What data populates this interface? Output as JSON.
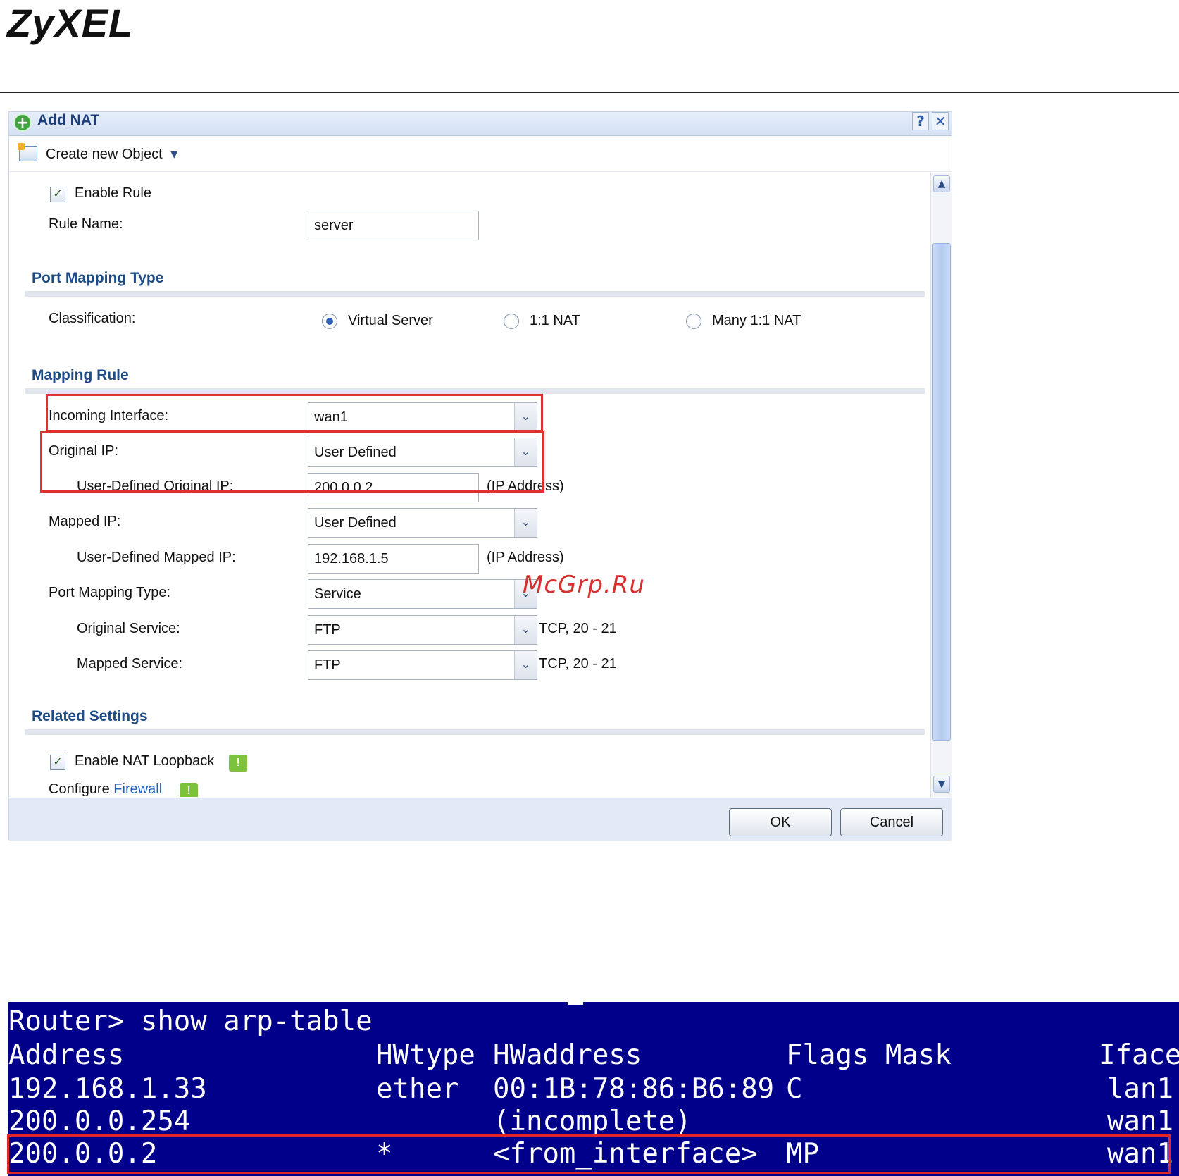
{
  "brand": "ZyXEL",
  "dialog": {
    "title": "Add NAT",
    "help_btn": "?",
    "close_btn": "✕",
    "toolbar": {
      "create_label": "Create new Object",
      "caret": "▾"
    },
    "enable_rule": {
      "label": "Enable Rule",
      "checked": true,
      "mark": "✓"
    },
    "rule_name": {
      "label": "Rule Name:",
      "value": "server"
    },
    "sections": {
      "port_mapping_type": "Port Mapping Type",
      "mapping_rule": "Mapping Rule",
      "related_settings": "Related Settings"
    },
    "classification": {
      "label": "Classification:",
      "options": [
        "Virtual Server",
        "1:1 NAT",
        "Many 1:1 NAT"
      ],
      "selected": "Virtual Server"
    },
    "incoming_interface": {
      "label": "Incoming Interface:",
      "value": "wan1"
    },
    "original_ip": {
      "label": "Original IP:",
      "value": "User Defined"
    },
    "user_defined_original_ip": {
      "label": "User-Defined Original IP:",
      "value": "200.0.0.2",
      "hint": "(IP Address)"
    },
    "mapped_ip": {
      "label": "Mapped IP:",
      "value": "User Defined"
    },
    "user_defined_mapped_ip": {
      "label": "User-Defined Mapped IP:",
      "value": "192.168.1.5",
      "hint": "(IP Address)"
    },
    "port_mapping_type": {
      "label": "Port Mapping Type:",
      "value": "Service"
    },
    "original_service": {
      "label": "Original Service:",
      "value": "FTP",
      "hint": "TCP, 20 - 21"
    },
    "mapped_service": {
      "label": "Mapped Service:",
      "value": "FTP",
      "hint": "TCP, 20 - 21"
    },
    "nat_loopback": {
      "label": "Enable NAT Loopback",
      "checked": true,
      "mark": "✓"
    },
    "configure_firewall": {
      "prefix": "Configure ",
      "link": "Firewall"
    },
    "warn_mark": "!",
    "dropdown_arrow": "⌄",
    "scroll_up": "▲",
    "scroll_down": "▼",
    "ok_label": "OK",
    "cancel_label": "Cancel"
  },
  "watermark": "McGrp.Ru",
  "terminal": {
    "command": "Router> show arp-table",
    "headers": {
      "address": "Address",
      "hwtype": "HWtype",
      "hwaddress": "HWaddress",
      "flags": "Flags Mask",
      "iface": "Iface"
    },
    "rows": [
      {
        "address": "192.168.1.33",
        "hwtype": "ether",
        "hwaddress": "00:1B:78:86:B6:89",
        "flags": "C",
        "iface": "lan1"
      },
      {
        "address": "200.0.0.254",
        "hwtype": "",
        "hwaddress": "(incomplete)",
        "flags": "",
        "iface": "wan1"
      },
      {
        "address": "200.0.0.2",
        "hwtype": "*",
        "hwaddress": "<from_interface>",
        "flags": "MP",
        "iface": "wan1"
      }
    ]
  },
  "colors": {
    "highlight": "#e03030",
    "terminal_bg": "#00008b",
    "section_title": "#1d4c86"
  }
}
